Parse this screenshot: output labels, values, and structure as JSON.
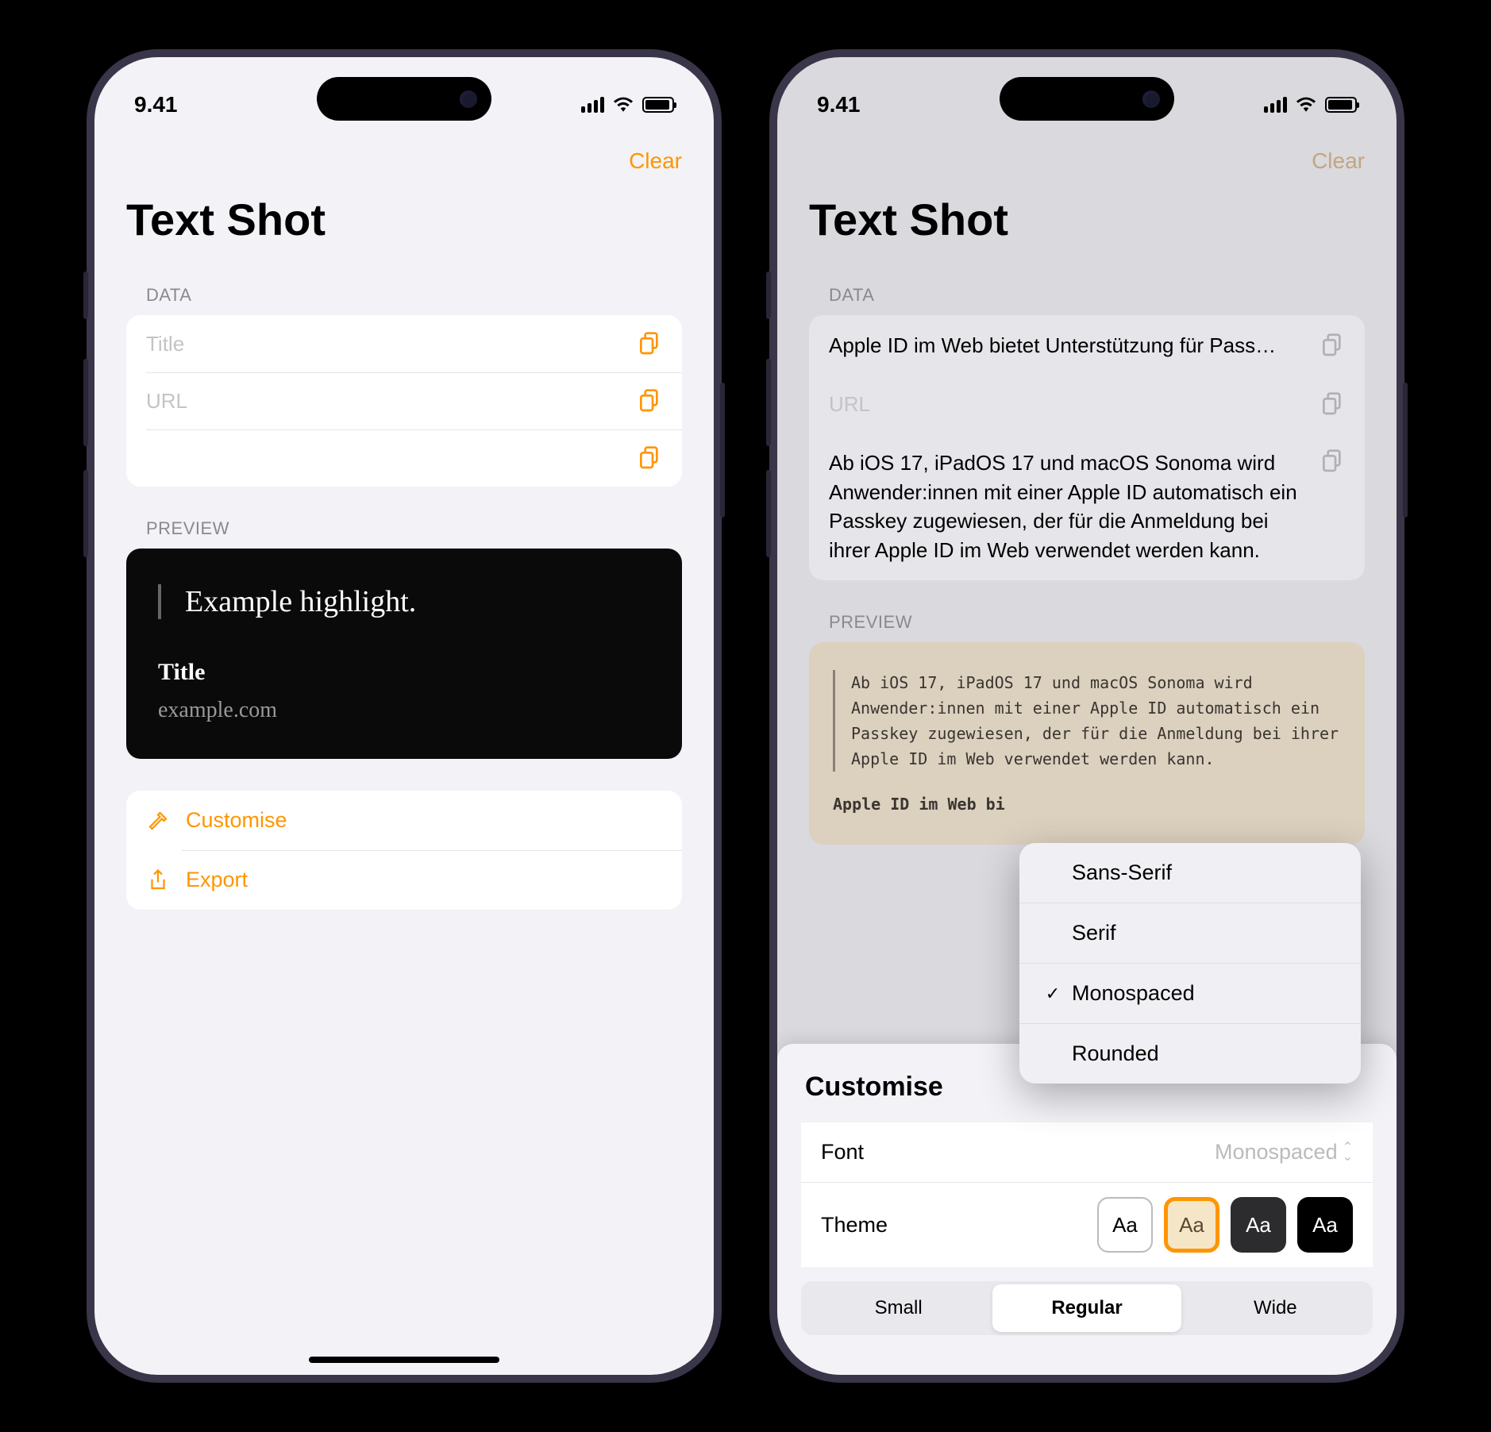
{
  "status": {
    "time": "9.41"
  },
  "nav": {
    "clear": "Clear"
  },
  "app_title": "Text Shot",
  "sections": {
    "data": "DATA",
    "preview": "PREVIEW"
  },
  "phone1": {
    "fields": {
      "title_placeholder": "Title",
      "url_placeholder": "URL",
      "title_value": "",
      "url_value": "",
      "body_value": ""
    },
    "preview": {
      "quote": "Example highlight.",
      "title": "Title",
      "url": "example.com"
    },
    "actions": {
      "customise": "Customise",
      "export": "Export"
    }
  },
  "phone2": {
    "fields": {
      "title_value": "Apple ID im Web bietet Unterstützung für Pass…",
      "url_placeholder": "URL",
      "body_value": "Ab iOS 17, iPadOS 17 und macOS Sonoma wird Anwender:innen mit einer Apple ID automatisch ein Passkey zugewiesen, der für die Anmeldung bei ihrer Apple ID im Web verwendet werden kann."
    },
    "preview": {
      "quote": "Ab iOS 17, iPadOS 17 und macOS Sonoma wird Anwender:innen mit einer Apple ID automatisch ein Passkey zugewiesen, der für die Anmeldung bei ihrer Apple ID im Web verwendet werden kann.",
      "title": "Apple ID im Web bi"
    },
    "customise_sheet": {
      "title": "Customise",
      "font_label": "Font",
      "font_selected": "Monospaced",
      "theme_label": "Theme",
      "swatch_text": "Aa",
      "aspect": {
        "small": "Small",
        "regular": "Regular",
        "wide": "Wide"
      }
    },
    "font_menu": {
      "sans": "Sans-Serif",
      "serif": "Serif",
      "mono": "Monospaced",
      "rounded": "Rounded"
    }
  }
}
